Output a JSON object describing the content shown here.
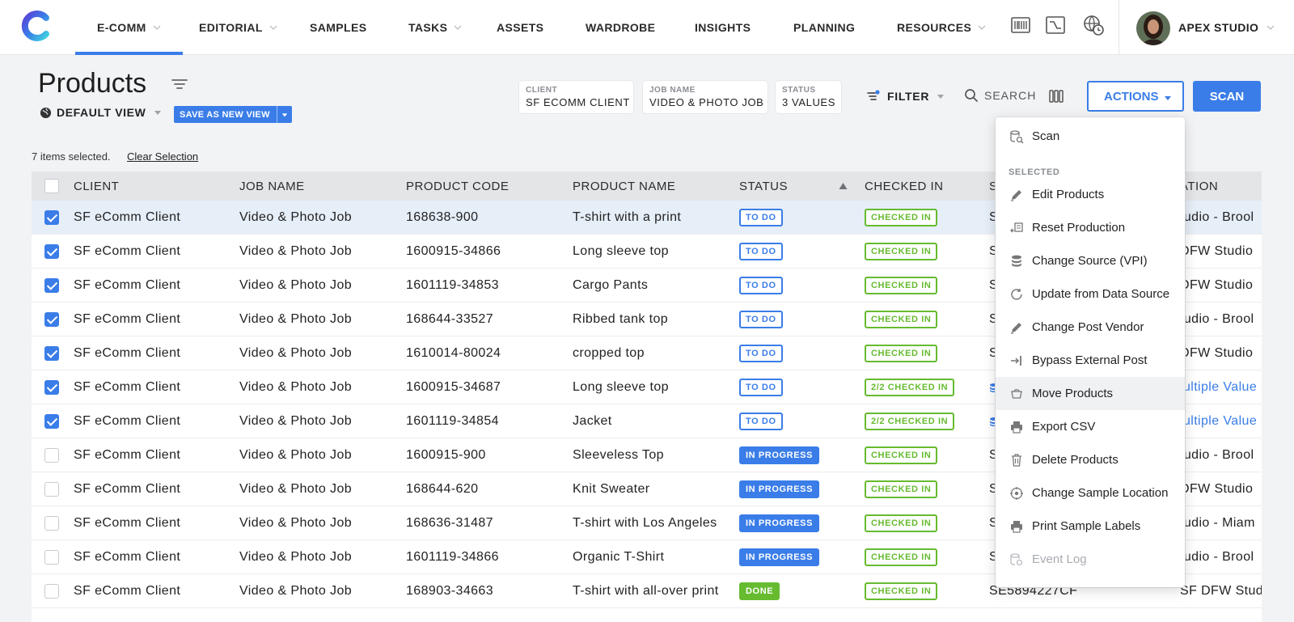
{
  "nav": {
    "items": [
      {
        "label": "E-COMM",
        "has_caret": true
      },
      {
        "label": "EDITORIAL",
        "has_caret": true
      },
      {
        "label": "SAMPLES",
        "has_caret": false
      },
      {
        "label": "TASKS",
        "has_caret": true
      },
      {
        "label": "ASSETS",
        "has_caret": false
      },
      {
        "label": "WARDROBE",
        "has_caret": false
      },
      {
        "label": "INSIGHTS",
        "has_caret": false
      },
      {
        "label": "PLANNING",
        "has_caret": false
      },
      {
        "label": "RESOURCES",
        "has_caret": true
      }
    ],
    "active": "E-COMM",
    "studio": "APEX STUDIO",
    "icons": [
      "barcode-icon",
      "chart-window-icon",
      "globe-clock-icon"
    ]
  },
  "header": {
    "title": "Products",
    "view_label": "DEFAULT VIEW",
    "save_view_label": "SAVE AS NEW VIEW",
    "chips": [
      {
        "label": "CLIENT",
        "value": "SF ECOMM CLIENT"
      },
      {
        "label": "JOB NAME",
        "value": "VIDEO & PHOTO JOB"
      },
      {
        "label": "STATUS",
        "value": "3 VALUES"
      }
    ],
    "filter_label": "FILTER",
    "search_label": "SEARCH",
    "actions_label": "ACTIONS",
    "scan_label": "SCAN"
  },
  "selection": {
    "info": "7 items selected.",
    "clear_label": "Clear Selection"
  },
  "table": {
    "columns": [
      "CLIENT",
      "JOB NAME",
      "PRODUCT CODE",
      "PRODUCT NAME",
      "STATUS",
      "CHECKED IN",
      "S",
      "ATION"
    ],
    "sorted_column": "STATUS",
    "rows": [
      {
        "selected": true,
        "client": "SF eComm Client",
        "job": "Video & Photo Job",
        "code": "168638-900",
        "name": "T-shirt with a print",
        "status": "TO DO",
        "checked": "CHECKED IN",
        "source": "S",
        "location": "tudio - Brool",
        "location_link": false,
        "highlight": true
      },
      {
        "selected": true,
        "client": "SF eComm Client",
        "job": "Video & Photo Job",
        "code": "1600915-34866",
        "name": "Long sleeve top",
        "status": "TO DO",
        "checked": "CHECKED IN",
        "source": "S",
        "location": "DFW Studio",
        "location_link": false
      },
      {
        "selected": true,
        "client": "SF eComm Client",
        "job": "Video & Photo Job",
        "code": "1601119-34853",
        "name": "Cargo Pants",
        "status": "TO DO",
        "checked": "CHECKED IN",
        "source": "S",
        "location": "DFW Studio",
        "location_link": false
      },
      {
        "selected": true,
        "client": "SF eComm Client",
        "job": "Video & Photo Job",
        "code": "168644-33527",
        "name": "Ribbed tank top",
        "status": "TO DO",
        "checked": "CHECKED IN",
        "source": "S",
        "location": "tudio - Brool",
        "location_link": false
      },
      {
        "selected": true,
        "client": "SF eComm Client",
        "job": "Video & Photo Job",
        "code": "1610014-80024",
        "name": "cropped top",
        "status": "TO DO",
        "checked": "CHECKED IN",
        "source": "S",
        "location": "DFW Studio",
        "location_link": false
      },
      {
        "selected": true,
        "client": "SF eComm Client",
        "job": "Video & Photo Job",
        "code": "1600915-34687",
        "name": "Long sleeve top",
        "status": "TO DO",
        "checked": "2/2 CHECKED IN",
        "source": "",
        "location": "lultiple Value",
        "location_link": true
      },
      {
        "selected": true,
        "client": "SF eComm Client",
        "job": "Video & Photo Job",
        "code": "1601119-34854",
        "name": "Jacket",
        "status": "TO DO",
        "checked": "2/2 CHECKED IN",
        "source": "",
        "location": "lultiple Value",
        "location_link": true
      },
      {
        "selected": false,
        "client": "SF eComm Client",
        "job": "Video & Photo Job",
        "code": "1600915-900",
        "name": "Sleeveless Top",
        "status": "IN PROGRESS",
        "checked": "CHECKED IN",
        "source": "S",
        "location": "tudio - Brool",
        "location_link": false
      },
      {
        "selected": false,
        "client": "SF eComm Client",
        "job": "Video & Photo Job",
        "code": "168644-620",
        "name": "Knit Sweater",
        "status": "IN PROGRESS",
        "checked": "CHECKED IN",
        "source": "S",
        "location": "DFW Studio",
        "location_link": false
      },
      {
        "selected": false,
        "client": "SF eComm Client",
        "job": "Video & Photo Job",
        "code": "168636-31487",
        "name": "T-shirt with Los Angeles",
        "status": "IN PROGRESS",
        "checked": "CHECKED IN",
        "source": "S",
        "location": "tudio - Miam",
        "location_link": false
      },
      {
        "selected": false,
        "client": "SF eComm Client",
        "job": "Video & Photo Job",
        "code": "1601119-34866",
        "name": "Organic T-Shirt",
        "status": "IN PROGRESS",
        "checked": "CHECKED IN",
        "source": "S",
        "location": "tudio - Brool",
        "location_link": false
      },
      {
        "selected": false,
        "client": "SF eComm Client",
        "job": "Video & Photo Job",
        "code": "168903-34663",
        "name": "T-shirt with all-over print",
        "status": "DONE",
        "checked": "CHECKED IN",
        "source": "SE5894227CF",
        "location": "SF DFW Studio",
        "location_link": false
      }
    ]
  },
  "actions_menu": {
    "top_item": {
      "label": "Scan",
      "icon": "scan-icon"
    },
    "section_label": "SELECTED",
    "items": [
      {
        "label": "Edit Products",
        "icon": "pencil-icon"
      },
      {
        "label": "Reset Production",
        "icon": "reset-production-icon"
      },
      {
        "label": "Change Source (VPI)",
        "icon": "database-icon"
      },
      {
        "label": "Update from Data Source",
        "icon": "refresh-icon"
      },
      {
        "label": "Change Post Vendor",
        "icon": "pencil-icon"
      },
      {
        "label": "Bypass External Post",
        "icon": "bypass-arrow-icon"
      },
      {
        "label": "Move Products",
        "icon": "move-cart-icon"
      },
      {
        "label": "Export CSV",
        "icon": "printer-icon"
      },
      {
        "label": "Delete Products",
        "icon": "trash-icon"
      },
      {
        "label": "Change Sample Location",
        "icon": "location-icon"
      },
      {
        "label": "Print Sample Labels",
        "icon": "printer-icon"
      },
      {
        "label": "Event Log",
        "icon": "event-log-icon"
      }
    ],
    "hover_item": "Move Products",
    "disabled_item": "Event Log"
  },
  "colors": {
    "accent": "#3a7de8",
    "green": "#66bb2f",
    "header_bg": "#e4e5e7",
    "page_bg": "#f2f3f5"
  }
}
